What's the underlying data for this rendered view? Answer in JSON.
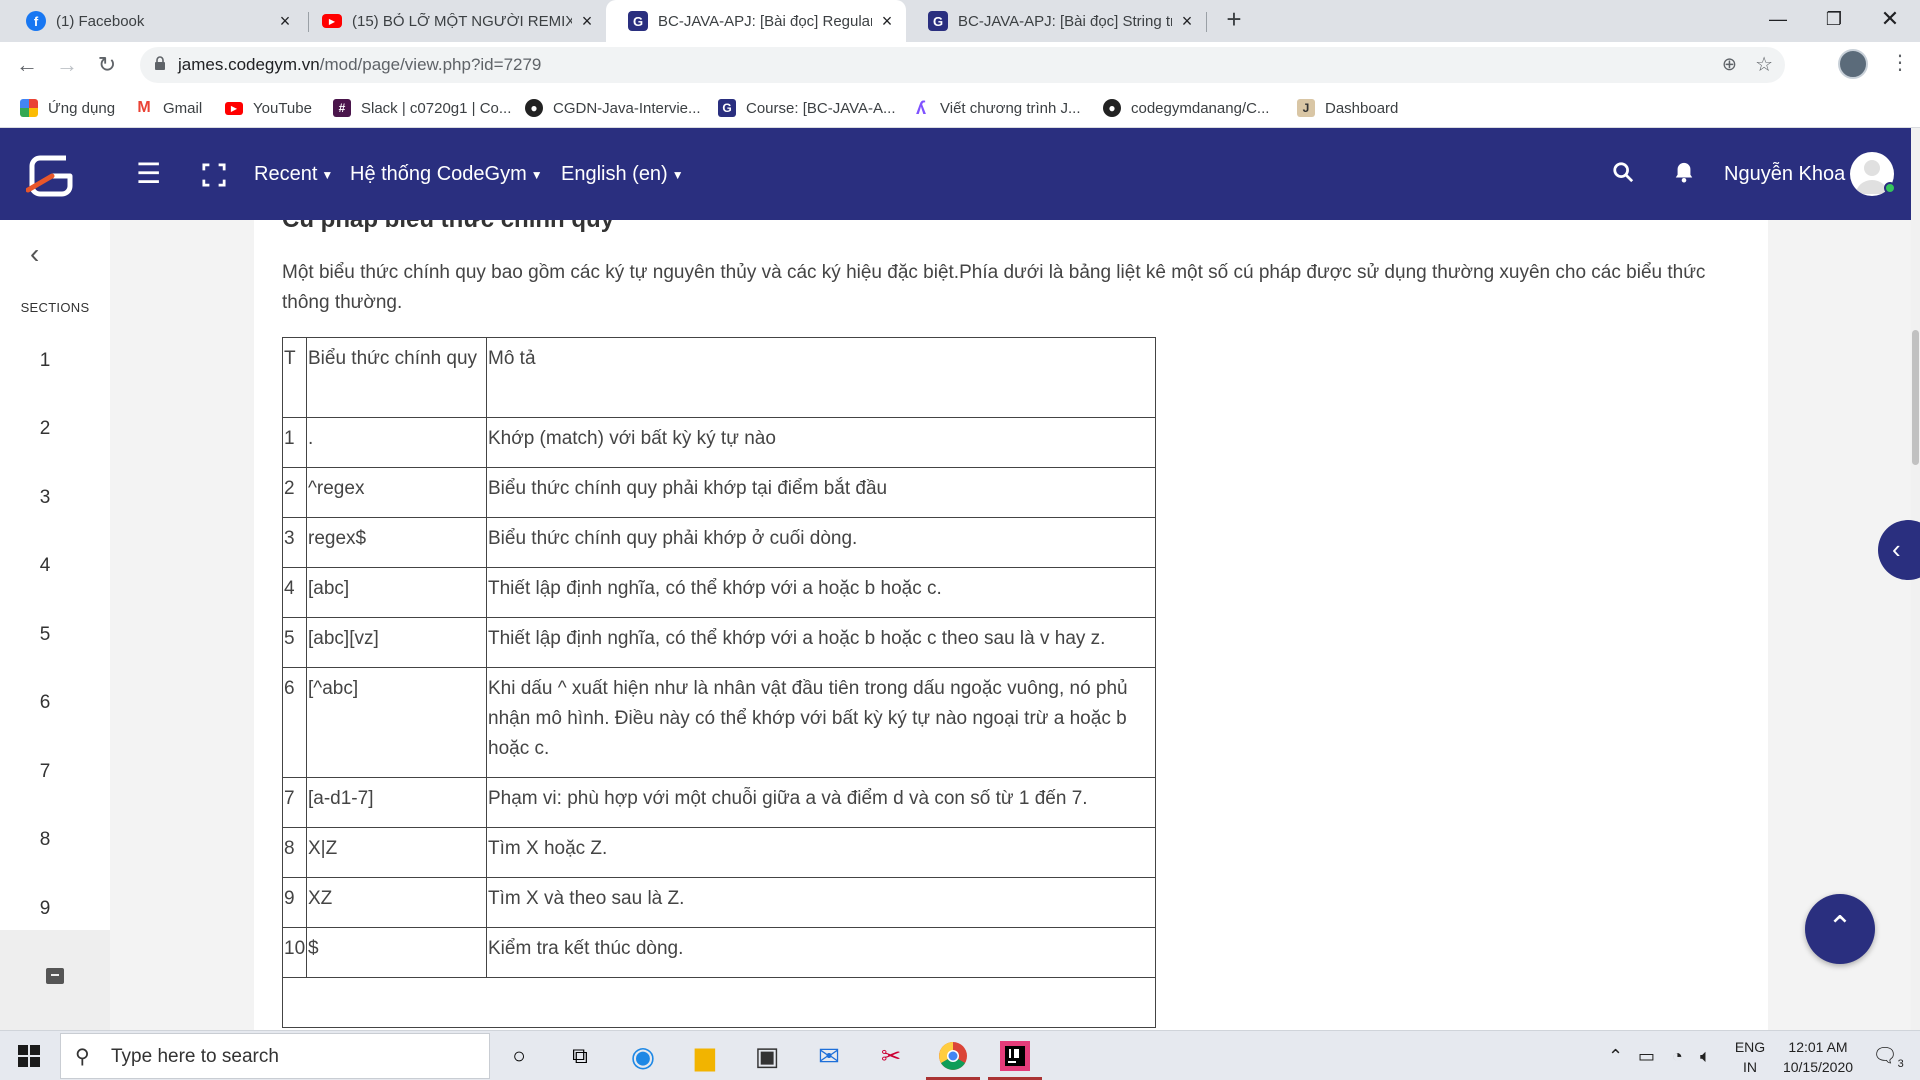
{
  "browser": {
    "tabs": [
      {
        "title": "(1) Facebook",
        "icon": "facebook-icon",
        "color": "#1877f2",
        "active": false
      },
      {
        "title": "(15) BỎ LỠ MỘT NGƯỜI REMIX ",
        "icon": "youtube-icon",
        "color": "#ff0000",
        "active": false
      },
      {
        "title": "BC-JAVA-APJ: [Bài đọc] Regular E",
        "icon": "codegym-icon",
        "color": "#2a2f7f",
        "active": true
      },
      {
        "title": "BC-JAVA-APJ: [Bài đọc] String trc",
        "icon": "codegym-icon",
        "color": "#2a2f7f",
        "active": false
      }
    ],
    "url_host": "james.codegym.vn",
    "url_path": "/mod/page/view.php?id=7279",
    "bookmarks": [
      {
        "label": "Ứng dụng",
        "icon": "apps-grid-icon"
      },
      {
        "label": "Gmail",
        "icon": "gmail-icon"
      },
      {
        "label": "YouTube",
        "icon": "youtube-icon"
      },
      {
        "label": "Slack | c0720g1 | Co...",
        "icon": "slack-icon"
      },
      {
        "label": "CGDN-Java-Intervie...",
        "icon": "github-icon"
      },
      {
        "label": "Course: [BC-JAVA-A...",
        "icon": "codegym-icon"
      },
      {
        "label": "Viết chương trình J...",
        "icon": "kotlin-icon"
      },
      {
        "label": "codegymdanang/C...",
        "icon": "github-icon"
      },
      {
        "label": "Dashboard",
        "icon": "jenkins-icon"
      }
    ]
  },
  "navbar": {
    "menus": [
      "Recent",
      "Hệ thống CodeGym",
      "English (en)"
    ],
    "user_name": "Nguyễn Khoa"
  },
  "drawer": {
    "label": "SECTIONS",
    "sections": [
      "1",
      "2",
      "3",
      "4",
      "5",
      "6",
      "7",
      "8",
      "9"
    ]
  },
  "content": {
    "heading": "Cú pháp biểu thức chính quy",
    "intro": "Một biểu thức chính quy bao gồm các ký tự nguyên thủy và các ký hiệu đặc biệt.Phía dưới là bảng liệt kê một số cú pháp được sử dụng thường xuyên cho các biểu thức thông thường.",
    "table": {
      "headers": [
        "T",
        "Biểu thức chính quy",
        "Mô tả"
      ],
      "rows": [
        [
          "1",
          ".",
          "Khớp (match) với bất kỳ ký tự nào"
        ],
        [
          "2",
          "^regex",
          "Biểu thức chính quy phải  khớp tại điểm bắt đầu"
        ],
        [
          "3",
          "regex$",
          "Biểu thức chính quy phải khớp ở cuối dòng."
        ],
        [
          "4",
          "[abc]",
          "Thiết lập định nghĩa, có thể khớp với a hoặc b hoặc c."
        ],
        [
          "5",
          "[abc][vz]",
          "Thiết lập định nghĩa, có thể khớp với a hoặc b hoặc c theo sau là v hay z."
        ],
        [
          "6",
          "[^abc]",
          "Khi dấu ^ xuất hiện như là nhân vật đầu tiên trong dấu ngoặc vuông, nó phủ nhận mô hình. Điều này có thể khớp với bất kỳ ký tự nào ngoại trừ a hoặc b hoặc c."
        ],
        [
          "7",
          "[a-d1-7]",
          "Phạm vi: phù hợp với một chuỗi giữa a và điểm d và con số từ 1 đến 7."
        ],
        [
          "8",
          "X|Z",
          "Tìm X hoặc Z."
        ],
        [
          "9",
          "XZ",
          "Tìm X và theo sau là Z."
        ],
        [
          "10",
          "$",
          "Kiểm tra kết thúc dòng."
        ]
      ]
    }
  },
  "taskbar": {
    "search_placeholder": "Type here to search",
    "lang_top": "ENG",
    "lang_bottom": "IN",
    "time": "12:01 AM",
    "date": "10/15/2020",
    "notification_count": "3"
  },
  "colors": {
    "navbar": "#2a2f7f",
    "tabstrip": "#dee1e6",
    "online": "#35c45c"
  }
}
